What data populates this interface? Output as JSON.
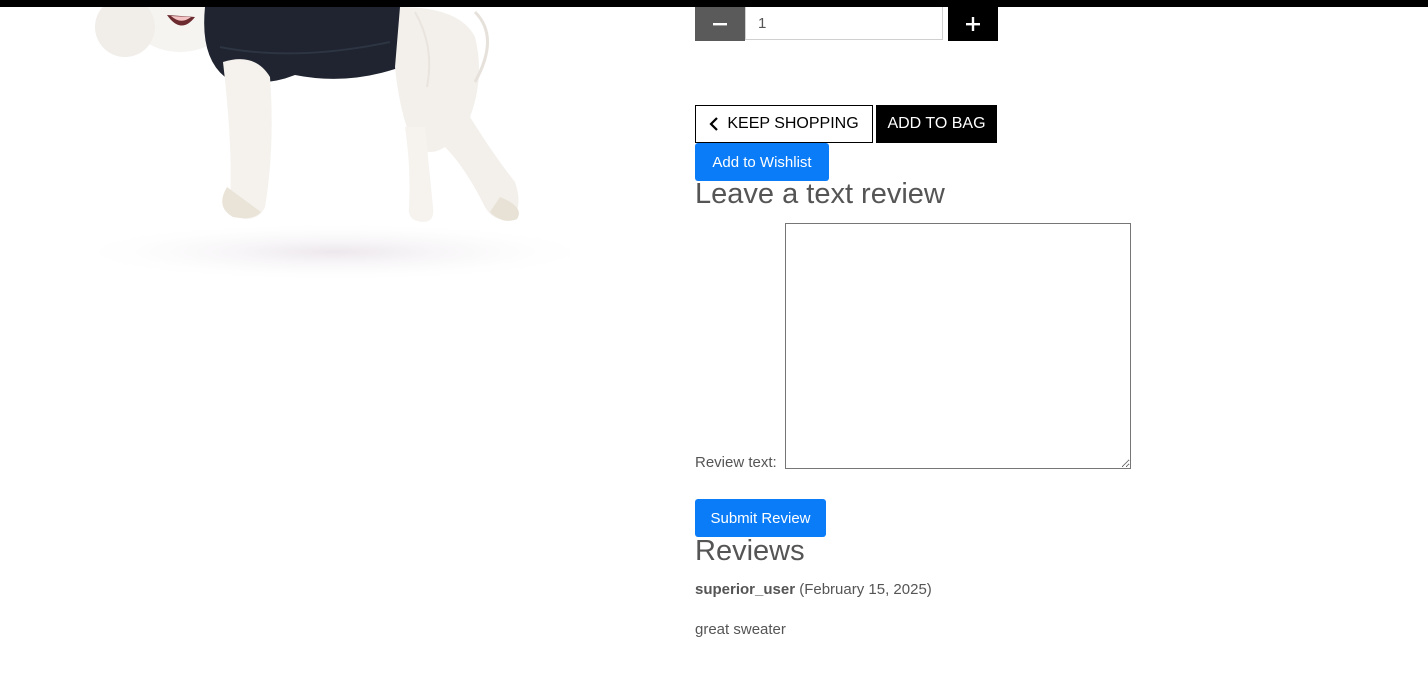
{
  "quantity": {
    "value": "1",
    "decrement_icon": "minus-icon",
    "increment_icon": "plus-icon"
  },
  "actions": {
    "keep_shopping_label": "KEEP SHOPPING",
    "keep_shopping_icon": "chevron-left-icon",
    "add_to_bag_label": "ADD TO BAG",
    "add_to_wishlist_label": "Add to Wishlist"
  },
  "review_form": {
    "heading": "Leave a text review",
    "field_label": "Review text:",
    "field_value": "",
    "submit_label": "Submit Review"
  },
  "reviews": {
    "heading": "Reviews",
    "items": [
      {
        "user": "superior_user",
        "date": "(February 15, 2025)",
        "text": "great sweater"
      }
    ]
  },
  "colors": {
    "primary_blue": "#0a7cf7",
    "black": "#000000",
    "text_gray": "#555555",
    "stepper_gray": "#5a5a5a",
    "sweater": "#1f2430"
  }
}
